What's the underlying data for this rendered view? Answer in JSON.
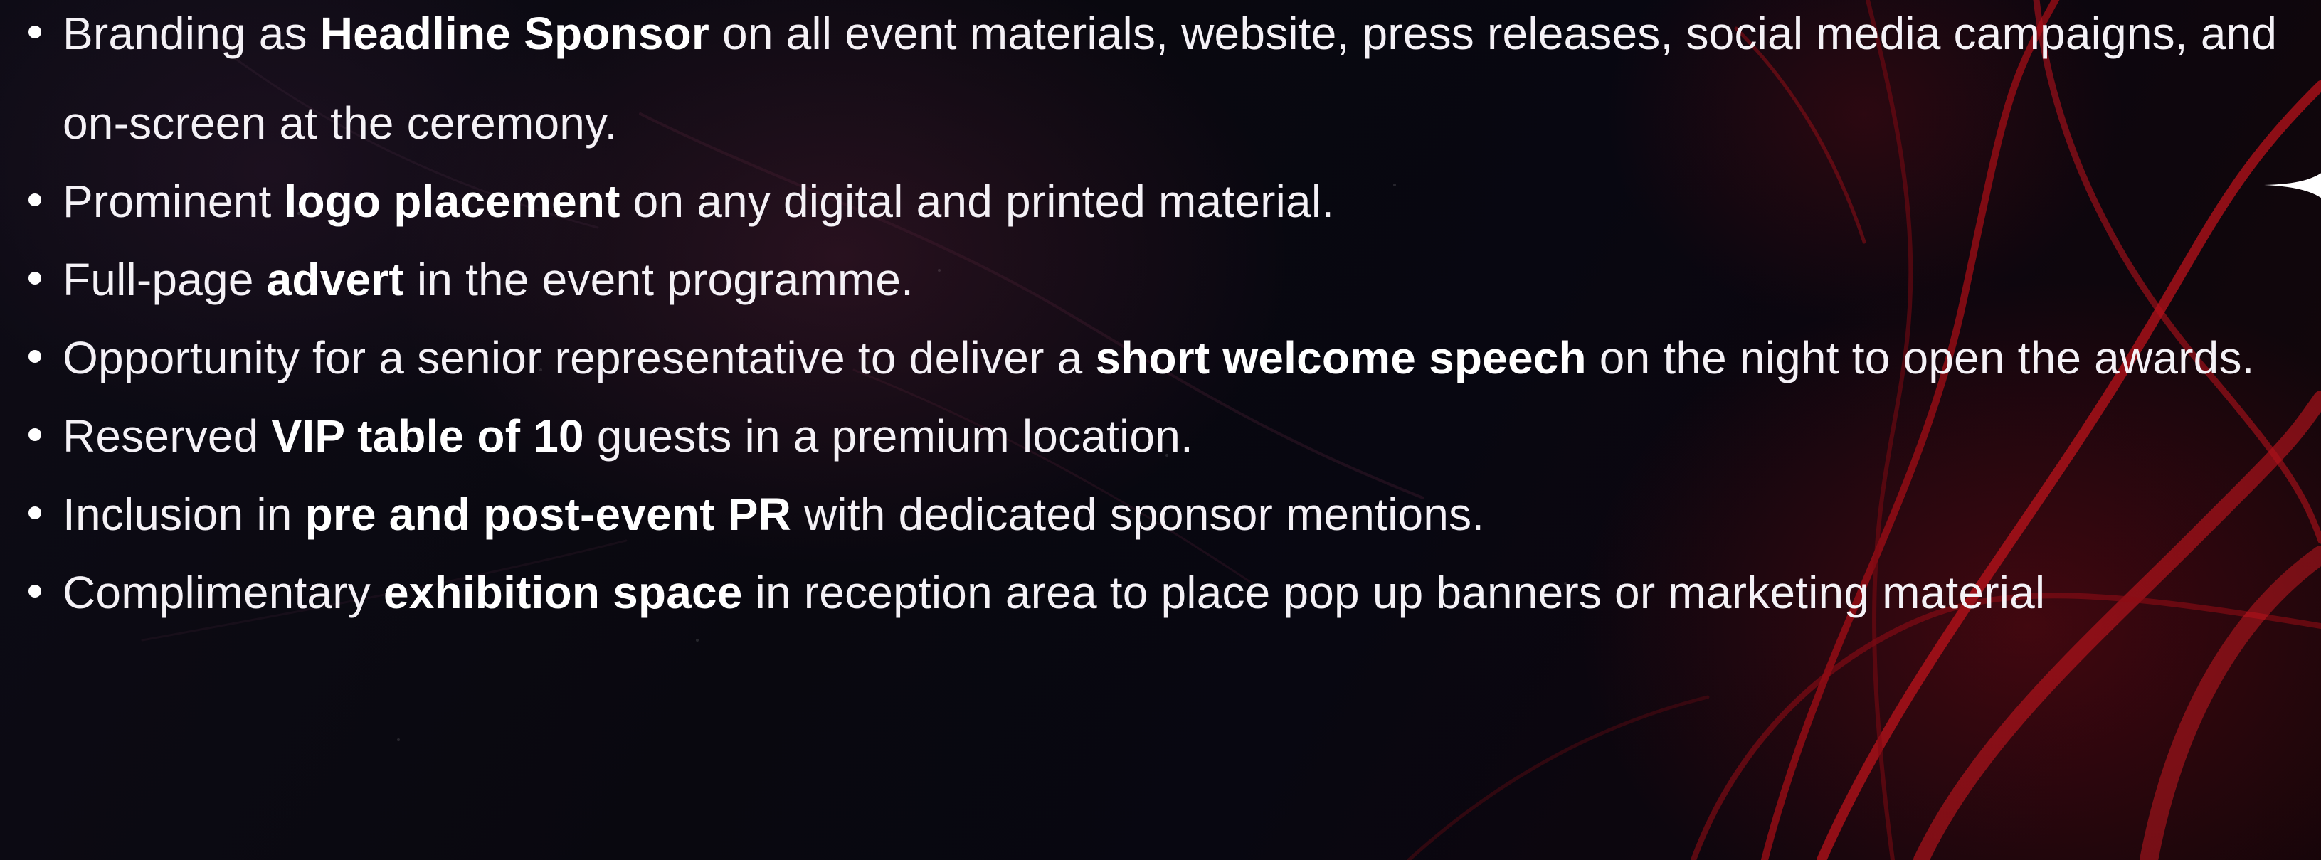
{
  "theme": {
    "background": "#07070c",
    "text": "#f4f1f6",
    "accent_red": "#c0141c",
    "bullet": "#ffffff"
  },
  "benefits": [
    {
      "before": "Branding as ",
      "bold": "Headline Sponsor",
      "after": " on all event materials, website, press releases, social media campaigns, and on-screen at the ceremony."
    },
    {
      "before": "Prominent ",
      "bold": "logo placement",
      "after": " on any digital and printed material."
    },
    {
      "before": "Full-page ",
      "bold": "advert",
      "after": " in the event programme."
    },
    {
      "before": "Opportunity for a senior representative to deliver a ",
      "bold": "short welcome speech",
      "after": " on the night to open the awards."
    },
    {
      "before": "Reserved ",
      "bold": "VIP table of 10",
      "after": " guests in a premium location."
    },
    {
      "before": "Inclusion in ",
      "bold": "pre and post-event PR",
      "after": " with dedicated sponsor mentions."
    },
    {
      "before": "Complimentary ",
      "bold": "exhibition space",
      "after": " in reception area to place pop up banners or marketing material"
    }
  ]
}
